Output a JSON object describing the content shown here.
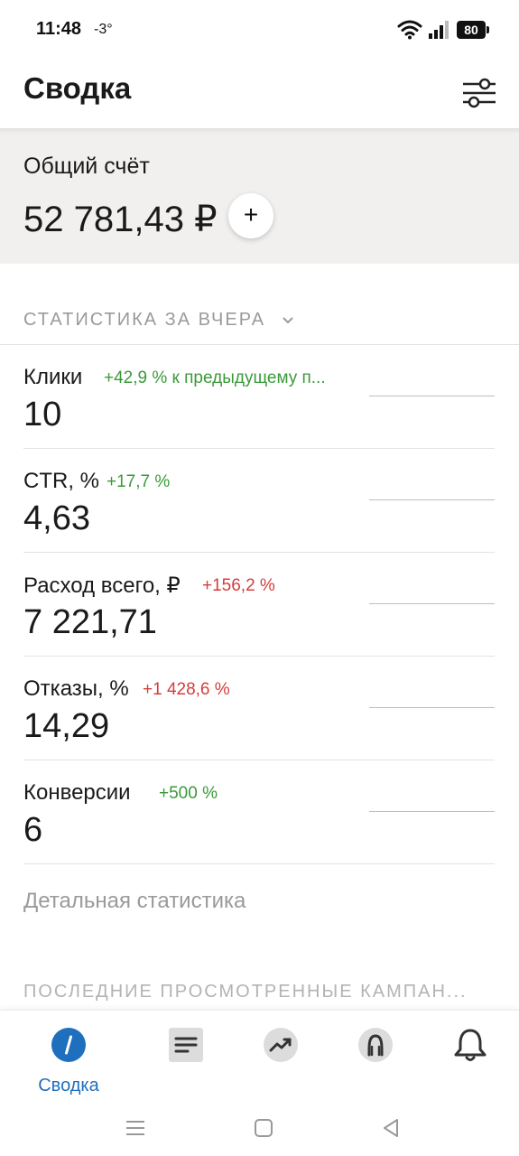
{
  "status_bar": {
    "time": "11:48",
    "temperature": "-3°",
    "battery": "80"
  },
  "header": {
    "title": "Сводка"
  },
  "balance": {
    "label": "Общий счёт",
    "amount": "52 781,43 ₽",
    "add_label": "+"
  },
  "stats": {
    "section_title": "СТАТИСТИКА ЗА ВЧЕРА",
    "metrics": [
      {
        "label": "Клики",
        "change": "+42,9 % к предыдущему п...",
        "trend": "up",
        "value": "10"
      },
      {
        "label": "CTR, %",
        "change": "+17,7 %",
        "trend": "up",
        "value": "4,63"
      },
      {
        "label": "Расход всего, ₽",
        "change": "+156,2 %",
        "trend": "negative",
        "value": "7 221,71"
      },
      {
        "label": "Отказы, %",
        "change": "+1 428,6 %",
        "trend": "negative",
        "value": "14,29"
      },
      {
        "label": "Конверсии",
        "change": "+500 %",
        "trend": "up",
        "value": "6"
      }
    ],
    "detail_link": "Детальная статистика"
  },
  "recent": {
    "section_title": "ПОСЛЕДНИЕ ПРОСМОТРЕННЫЕ КАМПАН..."
  },
  "bottom_nav": {
    "items": [
      {
        "label": "Сводка",
        "icon": "summary-icon",
        "active": true
      },
      {
        "label": "",
        "icon": "campaigns-icon",
        "active": false
      },
      {
        "label": "",
        "icon": "trending-icon",
        "active": false
      },
      {
        "label": "",
        "icon": "profile-icon",
        "active": false
      },
      {
        "label": "",
        "icon": "bell-icon",
        "active": false
      }
    ]
  },
  "colors": {
    "accent": "#1f6fbf",
    "positive": "#3b9a3b",
    "negative": "#d43d3d",
    "card_bg": "#f1f0ee"
  }
}
